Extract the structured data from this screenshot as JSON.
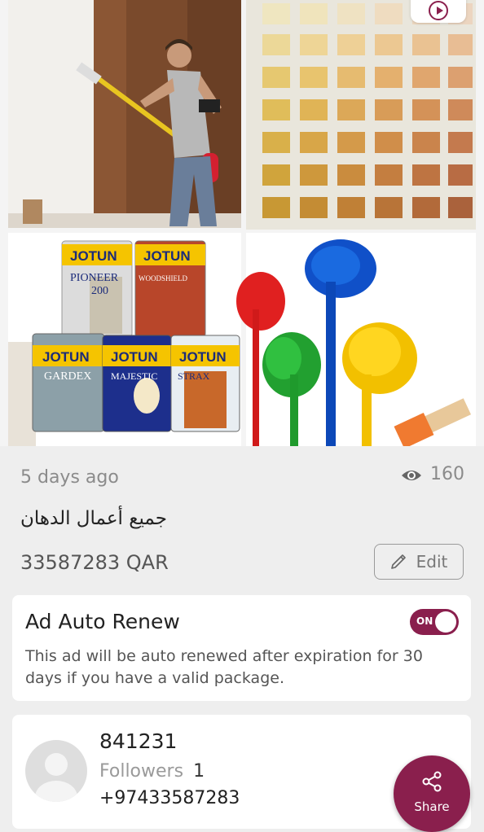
{
  "listing": {
    "posted_time": "5 days ago",
    "views": "160",
    "title": "جميع أعمال الدهان",
    "price": "33587283 QAR",
    "edit_label": "Edit"
  },
  "paint_cans": {
    "jotun_label": "JOTUN",
    "product_1": "PIONEER",
    "product_1_num": "200",
    "product_2": "WOODSHIELD",
    "product_3": "GARDEX",
    "product_4": "MAJESTIC",
    "product_5": "STRAX"
  },
  "auto_renew": {
    "title": "Ad Auto Renew",
    "toggle_label": "ON",
    "enabled": true,
    "description": "This ad will be auto renewed after expiration for 30 days if you have a valid package."
  },
  "seller": {
    "user_id": "841231",
    "followers_label": "Followers",
    "followers_count": "1",
    "phone": "+97433587283"
  },
  "share": {
    "label": "Share"
  },
  "colors": {
    "accent": "#8a1f4d",
    "background": "#eeeeee"
  }
}
